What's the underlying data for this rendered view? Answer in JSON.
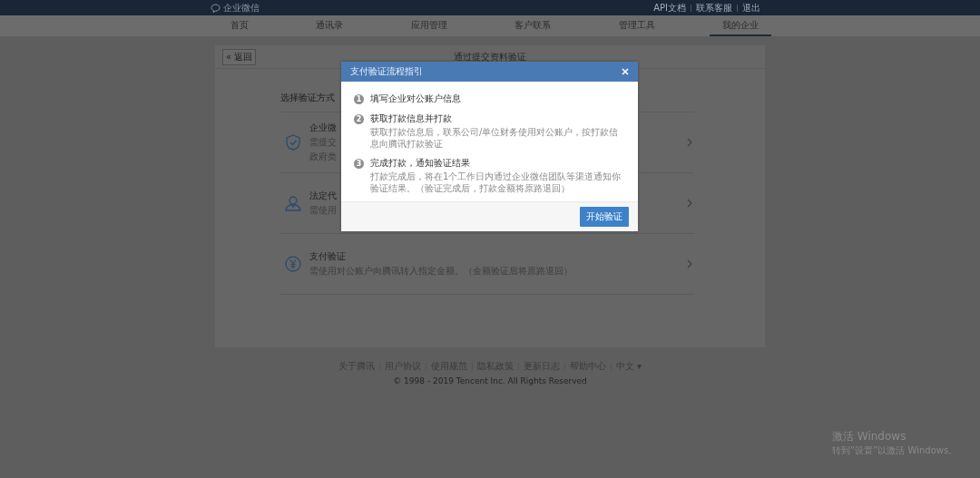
{
  "top_bar": {
    "logo": "企业微信",
    "links": [
      {
        "label": "API文档"
      },
      {
        "label": "联系客服"
      },
      {
        "label": "退出"
      }
    ]
  },
  "nav": [
    {
      "label": "首页",
      "selected": false
    },
    {
      "label": "通讯录",
      "selected": false
    },
    {
      "label": "应用管理",
      "selected": false
    },
    {
      "label": "客户联系",
      "selected": false
    },
    {
      "label": "管理工具",
      "selected": false
    },
    {
      "label": "我的企业",
      "selected": true
    }
  ],
  "page": {
    "back": "« 返回",
    "title": "通过提交资料验证",
    "section_label": "选择验证方式",
    "options": [
      {
        "kind": "shield",
        "title": "企业微",
        "description": [
          "需提交",
          "政府类"
        ]
      },
      {
        "kind": "person",
        "title": "法定代",
        "description": [
          "需使用"
        ]
      },
      {
        "kind": "yen",
        "title": "支付验证",
        "description": [
          "需使用对公账户向腾讯转入指定金额。（金额验证后将原路退回）"
        ]
      }
    ]
  },
  "dialog": {
    "title": "支付验证流程指引",
    "steps": [
      {
        "number": "1",
        "title": "填写企业对公账户信息"
      },
      {
        "number": "2",
        "title": "获取打款信息并打款",
        "description": "获取打款信息后，联系公司/单位财务使用对公账户，按打款信息向腾讯打款验证"
      },
      {
        "number": "3",
        "title": "完成打款，通知验证结果",
        "description": "打款完成后，将在1个工作日内通过企业微信团队等渠道通知你验证结果。（验证完成后，打款金额将原路退回）"
      }
    ],
    "button": "开始验证"
  },
  "footer": {
    "links": [
      {
        "label": "关于腾讯"
      },
      {
        "label": "用户协议"
      },
      {
        "label": "使用规范"
      },
      {
        "label": "隐私政策"
      },
      {
        "label": "更新日志"
      },
      {
        "label": "帮助中心"
      },
      {
        "label": "中文 ▾"
      }
    ],
    "copyright": "© 1998 - 2019 Tencent Inc. All Rights Reserved"
  },
  "os_notice": {
    "title": "激活 Windows",
    "subtitle": "转到“设置”以激活 Windows。"
  }
}
